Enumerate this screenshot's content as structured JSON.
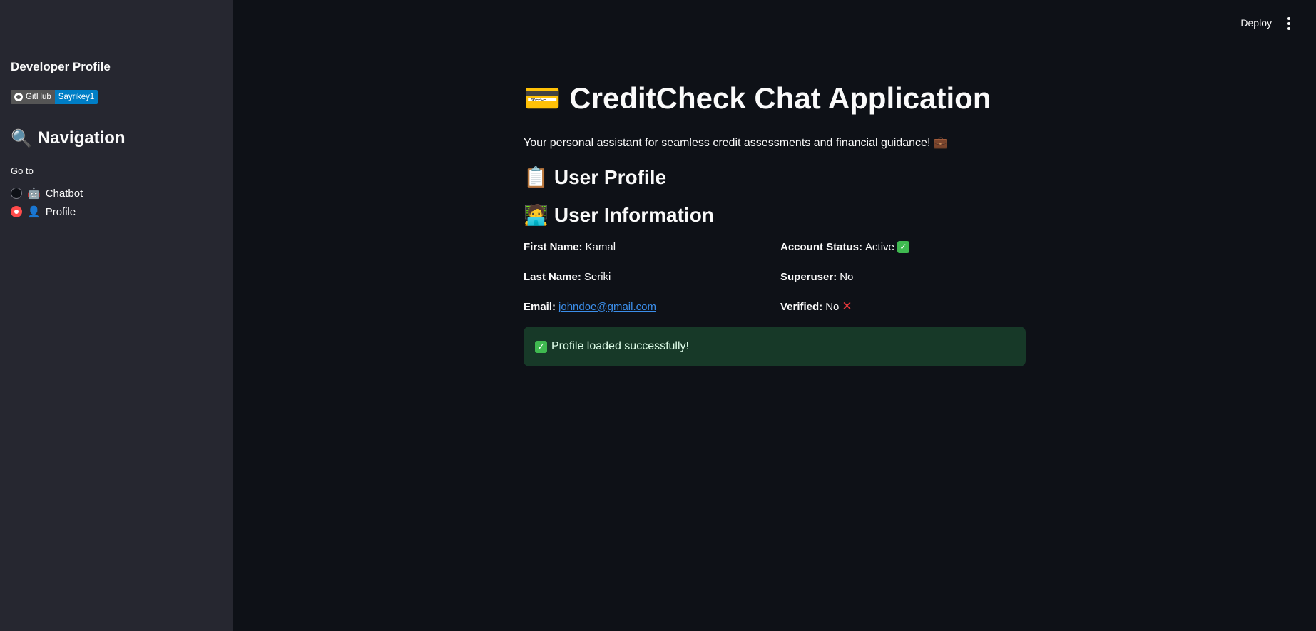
{
  "sidebar": {
    "developer_title": "Developer Profile",
    "badge": {
      "left_label": "GitHub",
      "right_label": "Sayrikey1"
    },
    "nav_icon": "🔍",
    "nav_title": "Navigation",
    "goto_label": "Go to",
    "options": [
      {
        "icon": "🤖",
        "label": "Chatbot",
        "selected": false
      },
      {
        "icon": "👤",
        "label": "Profile",
        "selected": true
      }
    ]
  },
  "header": {
    "deploy_label": "Deploy",
    "menu_icon": "vertical-ellipsis-icon"
  },
  "main": {
    "title_icon": "💳",
    "title": "CreditCheck Chat Application",
    "subtitle": "Your personal assistant for seamless credit assessments and financial guidance! 💼",
    "profile_icon": "📋",
    "profile_heading": "User Profile",
    "info_icon": "🧑‍💻",
    "info_heading": "User Information",
    "fields": {
      "first_name_label": "First Name:",
      "first_name": "Kamal",
      "last_name_label": "Last Name:",
      "last_name": "Seriki",
      "email_label": "Email:",
      "email": "johndoe@gmail.com",
      "account_status_label": "Account Status:",
      "account_status": "Active",
      "superuser_label": "Superuser:",
      "superuser": "No",
      "verified_label": "Verified:",
      "verified": "No"
    },
    "success_message": "Profile loaded successfully!"
  },
  "colors": {
    "background": "#0e1117",
    "sidebar": "#262730",
    "accent": "#ff4b4b",
    "success_bg": "#173928",
    "link": "#3b8eea",
    "badge_blue": "#007ec6"
  }
}
